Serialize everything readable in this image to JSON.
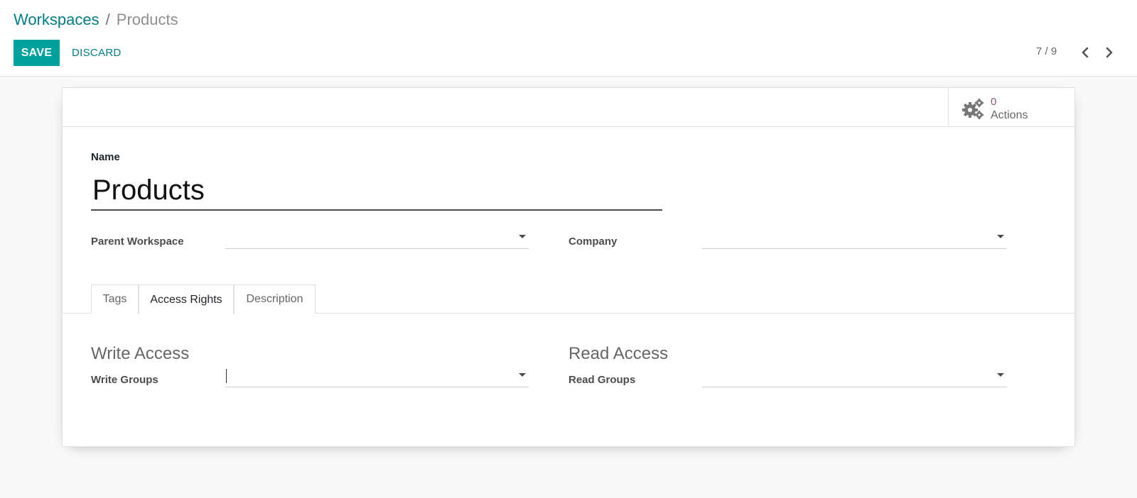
{
  "breadcrumb": {
    "parent": "Workspaces",
    "separator": "/",
    "current": "Products"
  },
  "toolbar": {
    "save_label": "SAVE",
    "discard_label": "DISCARD"
  },
  "pager": {
    "value": "7 / 9",
    "prev_icon": "chevron-left-icon",
    "next_icon": "chevron-right-icon"
  },
  "smart_button": {
    "icon": "gears-icon",
    "value": "0",
    "label": "Actions"
  },
  "form": {
    "name_label": "Name",
    "name_value": "Products",
    "parent_workspace_label": "Parent Workspace",
    "parent_workspace_value": "",
    "company_label": "Company",
    "company_value": ""
  },
  "tabs": [
    {
      "label": "Tags",
      "active": false
    },
    {
      "label": "Access Rights",
      "active": true
    },
    {
      "label": "Description",
      "active": false
    }
  ],
  "access_rights": {
    "write_title": "Write Access",
    "write_groups_label": "Write Groups",
    "write_groups_value": "",
    "read_title": "Read Access",
    "read_groups_label": "Read Groups",
    "read_groups_value": ""
  },
  "colors": {
    "primary": "#00a09d",
    "link": "#017e84",
    "stat_value": "#875a7b"
  }
}
